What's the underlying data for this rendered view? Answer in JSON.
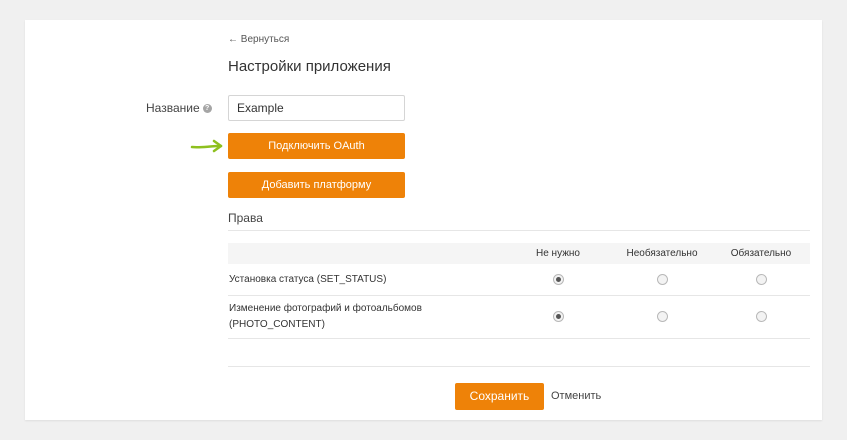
{
  "nav": {
    "back_label": "← Вернуться"
  },
  "page": {
    "title": "Настройки приложения"
  },
  "form": {
    "name_label": "Название",
    "name_help_icon": "help-icon",
    "name_value": "Example",
    "oauth_button": "Подключить OAuth",
    "platform_button": "Добавить платформу"
  },
  "rights": {
    "section_label": "Права",
    "columns": [
      "Не нужно",
      "Необязательно",
      "Обязательно"
    ],
    "rows": [
      {
        "name": "Установка статуса (SET_STATUS)",
        "selected": "Не нужно"
      },
      {
        "name": "Изменение фотографий и фотоальбомов (PHOTO_CONTENT)",
        "selected": "Не нужно"
      }
    ]
  },
  "footer": {
    "save_label": "Сохранить",
    "cancel_label": "Отменить"
  },
  "colors": {
    "accent": "#ee8208",
    "arrow": "#8ec01f",
    "background": "#f0f0f0"
  }
}
